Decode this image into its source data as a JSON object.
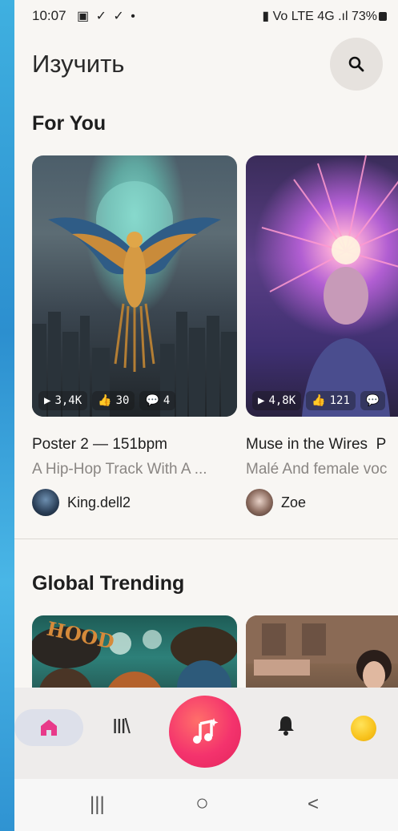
{
  "status": {
    "time": "10:07",
    "left_icons": "▣ ✓ ✓ •",
    "right": "▮ Vo LTE 4G .ıl 73%"
  },
  "header": {
    "title": "Изучить"
  },
  "sections": {
    "for_you": "For You",
    "trending": "Global Trending"
  },
  "for_you_cards": [
    {
      "title": "Poster 2 — 151bpm",
      "description": "A Hip-Hop Track With A ...",
      "author": "King.dell2",
      "plays": "3,4K",
      "likes": "30",
      "comments": "4"
    },
    {
      "title": "Muse in the Wires",
      "title_suffix": "P",
      "description": "Malé And female voc",
      "author": "Zoe",
      "plays": "4,8K",
      "likes": "121",
      "comments": ""
    }
  ],
  "trending_cards": [
    {
      "art_text": "HOOD"
    },
    {
      "art_text": ""
    }
  ],
  "bottom_nav": {
    "items": [
      "home",
      "library",
      "create",
      "notifications",
      "profile"
    ],
    "library_glyph": "III\\",
    "accent": "#f4336d"
  },
  "system_nav": {
    "recent": "|||",
    "home": "○",
    "back": "<"
  }
}
